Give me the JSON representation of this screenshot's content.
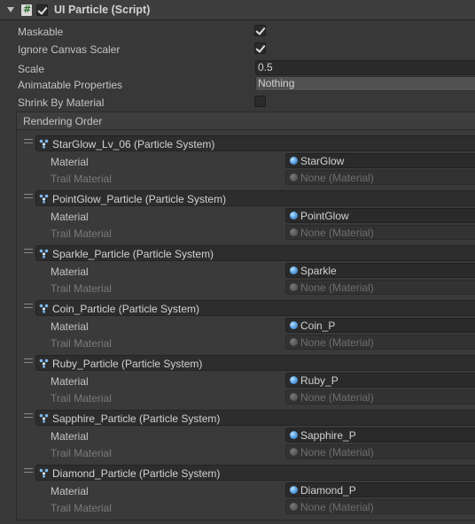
{
  "component": {
    "title": "UI Particle (Script)",
    "enabled": true
  },
  "properties": {
    "maskable": {
      "label": "Maskable",
      "checked": true
    },
    "ignore_canvas_scaler": {
      "label": "Ignore Canvas Scaler",
      "checked": true
    },
    "scale": {
      "label": "Scale",
      "value": "0.5"
    },
    "animatable_properties": {
      "label": "Animatable Properties",
      "value": "Nothing"
    },
    "shrink_by_material": {
      "label": "Shrink By Material",
      "checked": false
    }
  },
  "rendering_order": {
    "title": "Rendering Order",
    "material_label": "Material",
    "trail_material_label": "Trail Material",
    "trail_material_value": "None (Material)",
    "entries": [
      {
        "name": "StarGlow_Lv_06 (Particle System)",
        "material": "StarGlow"
      },
      {
        "name": "PointGlow_Particle (Particle System)",
        "material": "PointGlow"
      },
      {
        "name": "Sparkle_Particle (Particle System)",
        "material": "Sparkle"
      },
      {
        "name": "Coin_Particle (Particle System)",
        "material": "Coin_P"
      },
      {
        "name": "Ruby_Particle (Particle System)",
        "material": "Ruby_P"
      },
      {
        "name": "Sapphire_Particle (Particle System)",
        "material": "Sapphire_P"
      },
      {
        "name": "Diamond_Particle (Particle System)",
        "material": "Diamond_P"
      }
    ]
  },
  "icons": {
    "foldout": "chevron-down-icon",
    "script": "script-icon",
    "particle_system": "particle-system-icon",
    "material": "material-icon",
    "drag_handle": "drag-handle-icon"
  }
}
